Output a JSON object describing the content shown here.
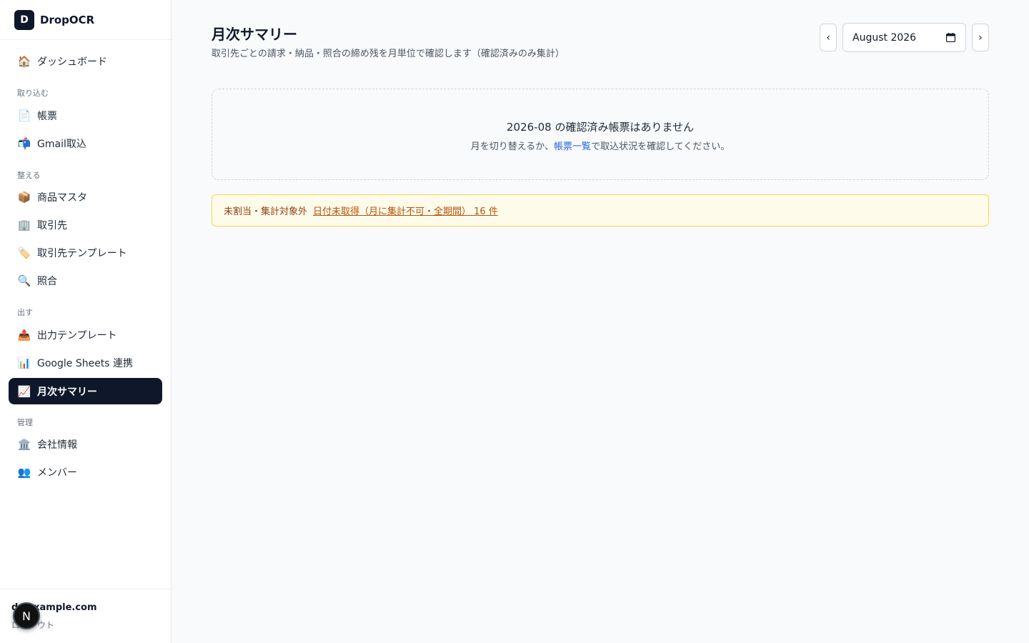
{
  "app": {
    "logo_letter": "D",
    "name": "DropOCR"
  },
  "sidebar": {
    "dashboard": {
      "icon": "house-icon",
      "glyph": "🏠",
      "label": "ダッシュボード"
    },
    "sections": [
      {
        "label": "取り込む",
        "items": [
          {
            "icon": "document-icon",
            "glyph": "📄",
            "label": "帳票"
          },
          {
            "icon": "mailbox-icon",
            "glyph": "📬",
            "label": "Gmail取込"
          }
        ]
      },
      {
        "label": "整える",
        "items": [
          {
            "icon": "package-icon",
            "glyph": "📦",
            "label": "商品マスタ"
          },
          {
            "icon": "office-building-icon",
            "glyph": "🏢",
            "label": "取引先"
          },
          {
            "icon": "label-tag-icon",
            "glyph": "🏷️",
            "label": "取引先テンプレート"
          },
          {
            "icon": "magnifier-icon",
            "glyph": "🔍",
            "label": "照合"
          }
        ]
      },
      {
        "label": "出す",
        "items": [
          {
            "icon": "outbox-icon",
            "glyph": "📤",
            "label": "出力テンプレート"
          },
          {
            "icon": "bar-chart-icon",
            "glyph": "📊",
            "label": "Google Sheets 連携"
          },
          {
            "icon": "trend-chart-icon",
            "glyph": "📈",
            "label": "月次サマリー",
            "active": true
          }
        ]
      },
      {
        "label": "管理",
        "items": [
          {
            "icon": "classical-building-icon",
            "glyph": "🏛️",
            "label": "会社情報"
          },
          {
            "icon": "people-icon",
            "glyph": "👥",
            "label": "メンバー"
          }
        ]
      }
    ],
    "footer": {
      "email": "d@example.com",
      "logout": "ログアウト",
      "avatar_letter": "N"
    }
  },
  "main": {
    "title": "月次サマリー",
    "subtitle": "取引先ごとの請求・納品・照合の締め残を月単位で確認します（確認済みのみ集計）",
    "month_nav": {
      "prev": "‹",
      "next": "›",
      "value": "August 2026"
    },
    "empty_state": {
      "title": "2026-08 の確認済み帳票はありません",
      "desc_before": "月を切り替えるか、",
      "desc_link": "帳票一覧",
      "desc_after": "で取込状況を確認してください。"
    },
    "warning": {
      "label": "未割当・集計対象外",
      "link": "日付未取得（月に集計不可・全期間） 16 件"
    }
  }
}
